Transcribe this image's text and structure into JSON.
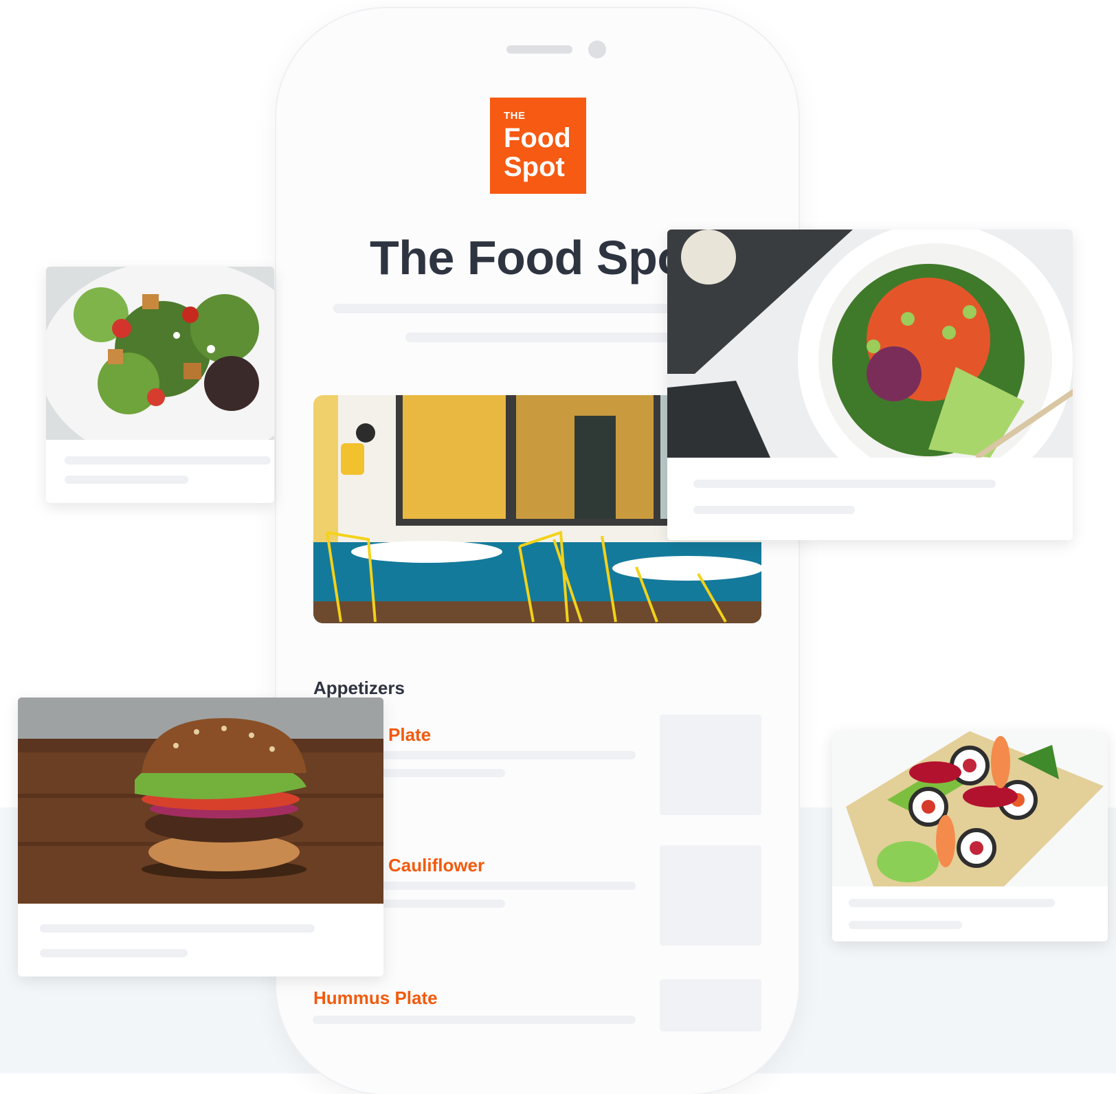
{
  "app": {
    "logo": {
      "small": "THE",
      "line1": "Food",
      "line2": "Spot"
    },
    "title": "The Food Spot"
  },
  "menu": {
    "section": "Appetizers",
    "items": [
      {
        "label": "Plate"
      },
      {
        "label": "Cauliflower"
      },
      {
        "label": "Hummus Plate"
      }
    ]
  },
  "colors": {
    "brand": "#f65a13",
    "item_title": "#f25a0e",
    "title_text": "#2e3440"
  },
  "icons": {
    "speaker": "phone-speaker",
    "camera": "phone-camera"
  }
}
